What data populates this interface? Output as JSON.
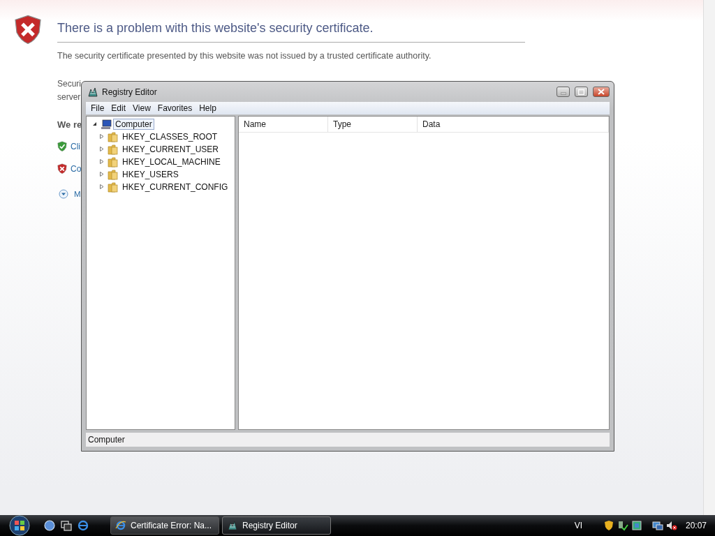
{
  "page": {
    "heading": "There is a problem with this website's security certificate.",
    "description": "The security certificate presented by this website was not issued by a trusted certificate authority.",
    "paragraph_lines": [
      "Securi",
      "server"
    ],
    "recommendation": "We re",
    "options": [
      {
        "kind": "safe",
        "label": "Cli"
      },
      {
        "kind": "unsafe",
        "label": "Co"
      }
    ],
    "more": "M"
  },
  "window": {
    "title": "Registry Editor",
    "menu": [
      "File",
      "Edit",
      "View",
      "Favorites",
      "Help"
    ],
    "tree": [
      {
        "label": "Computer",
        "selected": true,
        "expanded": true,
        "children": [
          {
            "label": "HKEY_CLASSES_ROOT",
            "selected": false,
            "expanded": false
          },
          {
            "label": "HKEY_CURRENT_USER",
            "selected": false,
            "expanded": false
          },
          {
            "label": "HKEY_LOCAL_MACHINE",
            "selected": false,
            "expanded": false
          },
          {
            "label": "HKEY_USERS",
            "selected": false,
            "expanded": false
          },
          {
            "label": "HKEY_CURRENT_CONFIG",
            "selected": false,
            "expanded": false
          }
        ]
      }
    ],
    "columns": [
      "Name",
      "Type",
      "Data"
    ],
    "status": "Computer"
  },
  "taskbar": {
    "buttons": [
      {
        "label": "Certificate Error: Na...",
        "kind": "browser",
        "selected": false
      },
      {
        "label": "Registry Editor",
        "kind": "registry",
        "selected": true
      }
    ],
    "language": "VI",
    "clock": "20:07"
  }
}
